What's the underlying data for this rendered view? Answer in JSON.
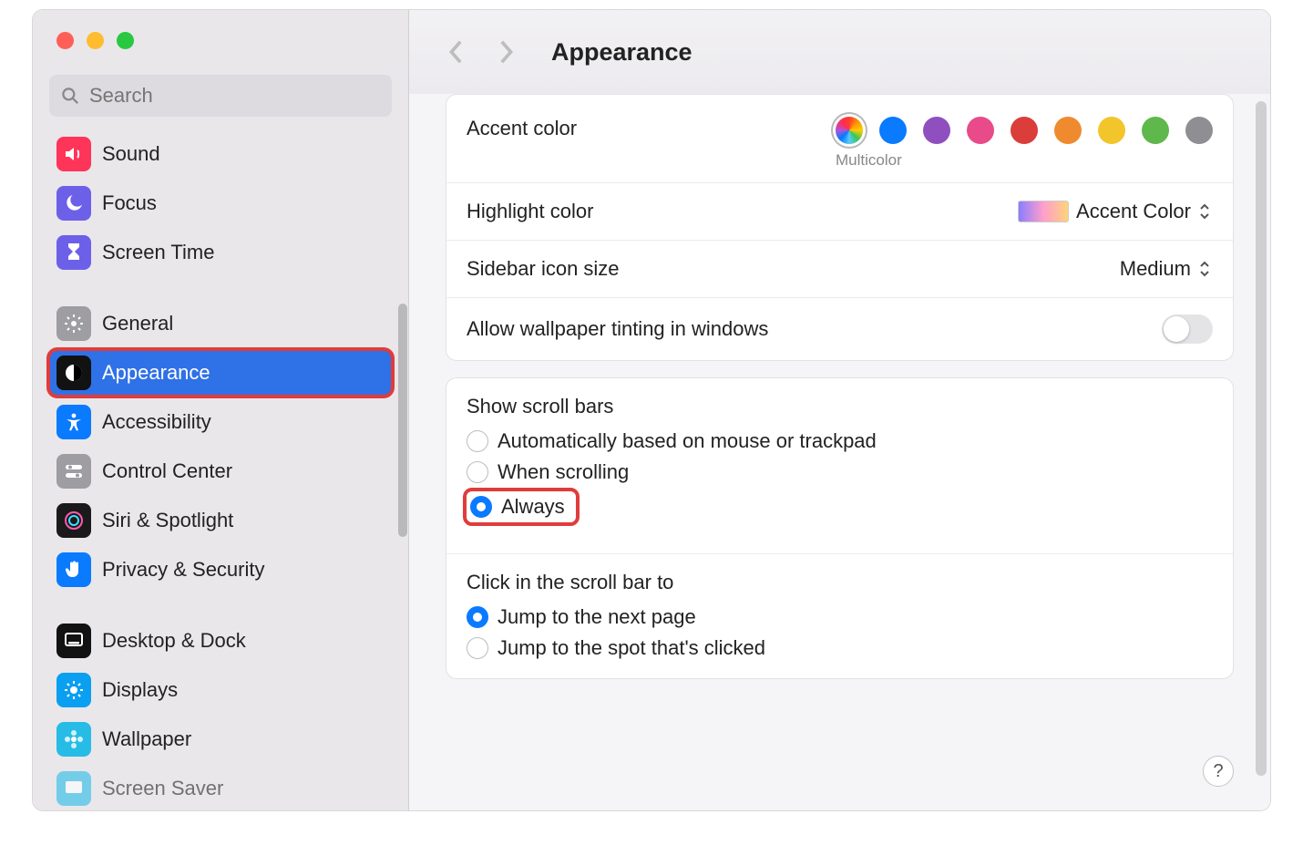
{
  "header": {
    "title": "Appearance"
  },
  "search": {
    "placeholder": "Search"
  },
  "sidebar": {
    "items": [
      {
        "label": "Sound"
      },
      {
        "label": "Focus"
      },
      {
        "label": "Screen Time"
      },
      {
        "label": "General"
      },
      {
        "label": "Appearance"
      },
      {
        "label": "Accessibility"
      },
      {
        "label": "Control Center"
      },
      {
        "label": "Siri & Spotlight"
      },
      {
        "label": "Privacy & Security"
      },
      {
        "label": "Desktop & Dock"
      },
      {
        "label": "Displays"
      },
      {
        "label": "Wallpaper"
      },
      {
        "label": "Screen Saver"
      }
    ]
  },
  "accent": {
    "label": "Accent color",
    "selected_label": "Multicolor",
    "colors": [
      "multicolor",
      "#0a7aff",
      "#8f4fbf",
      "#e94a89",
      "#db3d3a",
      "#ef8a2e",
      "#f2c52a",
      "#5eb84c",
      "#8e8e93"
    ]
  },
  "highlight": {
    "label": "Highlight color",
    "value": "Accent Color"
  },
  "sidebar_icon": {
    "label": "Sidebar icon size",
    "value": "Medium"
  },
  "wallpaper_tint": {
    "label": "Allow wallpaper tinting in windows",
    "on": false
  },
  "scrollbars": {
    "label": "Show scroll bars",
    "options": [
      "Automatically based on mouse or trackpad",
      "When scrolling",
      "Always"
    ],
    "selected": 2
  },
  "click_scroll": {
    "label": "Click in the scroll bar to",
    "options": [
      "Jump to the next page",
      "Jump to the spot that's clicked"
    ],
    "selected": 0
  }
}
